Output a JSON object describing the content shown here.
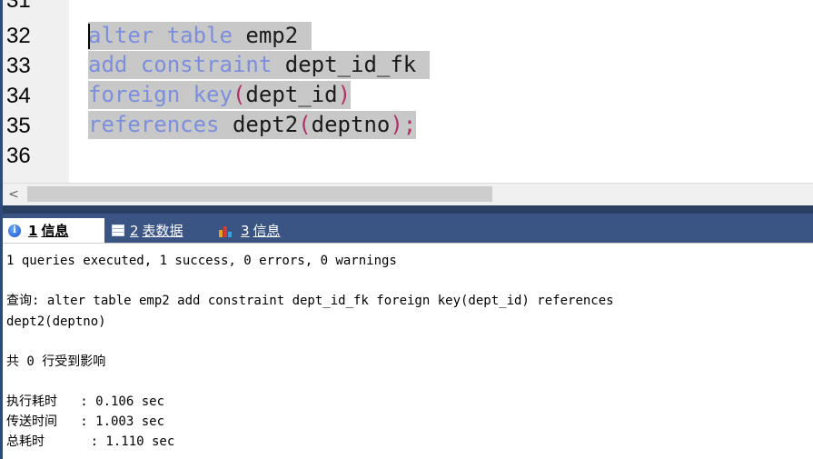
{
  "editor": {
    "line_numbers": [
      "31",
      "32",
      "33",
      "34",
      "35",
      "36"
    ],
    "lines": [
      [
        {
          "text": "alter",
          "cls": "kw"
        },
        {
          "text": " ",
          "cls": "id"
        },
        {
          "text": "table",
          "cls": "kw"
        },
        {
          "text": " emp2 ",
          "cls": "id"
        }
      ],
      [
        {
          "text": "add",
          "cls": "kw"
        },
        {
          "text": " ",
          "cls": "id"
        },
        {
          "text": "constraint",
          "cls": "kw"
        },
        {
          "text": " dept_id_fk ",
          "cls": "id"
        }
      ],
      [
        {
          "text": "foreign",
          "cls": "kw"
        },
        {
          "text": " ",
          "cls": "id"
        },
        {
          "text": "key",
          "cls": "kw"
        },
        {
          "text": "(",
          "cls": "pn"
        },
        {
          "text": "dept_id",
          "cls": "id"
        },
        {
          "text": ")",
          "cls": "pn"
        }
      ],
      [
        {
          "text": "references",
          "cls": "kw"
        },
        {
          "text": " dept2",
          "cls": "id"
        },
        {
          "text": "(",
          "cls": "pn"
        },
        {
          "text": "deptno",
          "cls": "id"
        },
        {
          "text": ");",
          "cls": "pn"
        }
      ]
    ]
  },
  "scrollbar": {
    "left_arrow": "<"
  },
  "tabs": [
    {
      "num": "1",
      "label": "信息",
      "icon": "info-icon",
      "active": true
    },
    {
      "num": "2",
      "label": "表数据",
      "icon": "table-icon",
      "active": false
    },
    {
      "num": "3",
      "label": "信息",
      "icon": "chart-icon",
      "active": false
    }
  ],
  "messages": {
    "summary": "1 queries executed, 1 success, 0 errors, 0 warnings",
    "query_line1": "查询: alter table emp2 add constraint dept_id_fk foreign key(dept_id) references",
    "query_line2": "dept2(deptno)",
    "affected": "共 0 行受到影响",
    "exec_time": "执行耗时   : 0.106 sec",
    "transfer_time": "传送时间   : 1.003 sec",
    "total_time": "总耗时      : 1.110 sec"
  },
  "colors": {
    "keyword": "#7b8fdc",
    "identifier": "#1a1a1a",
    "punctuation": "#b0306a",
    "selection": "#c8c8c8",
    "panel_dark": "#2b3f63",
    "tabbar": "#3a5584"
  }
}
